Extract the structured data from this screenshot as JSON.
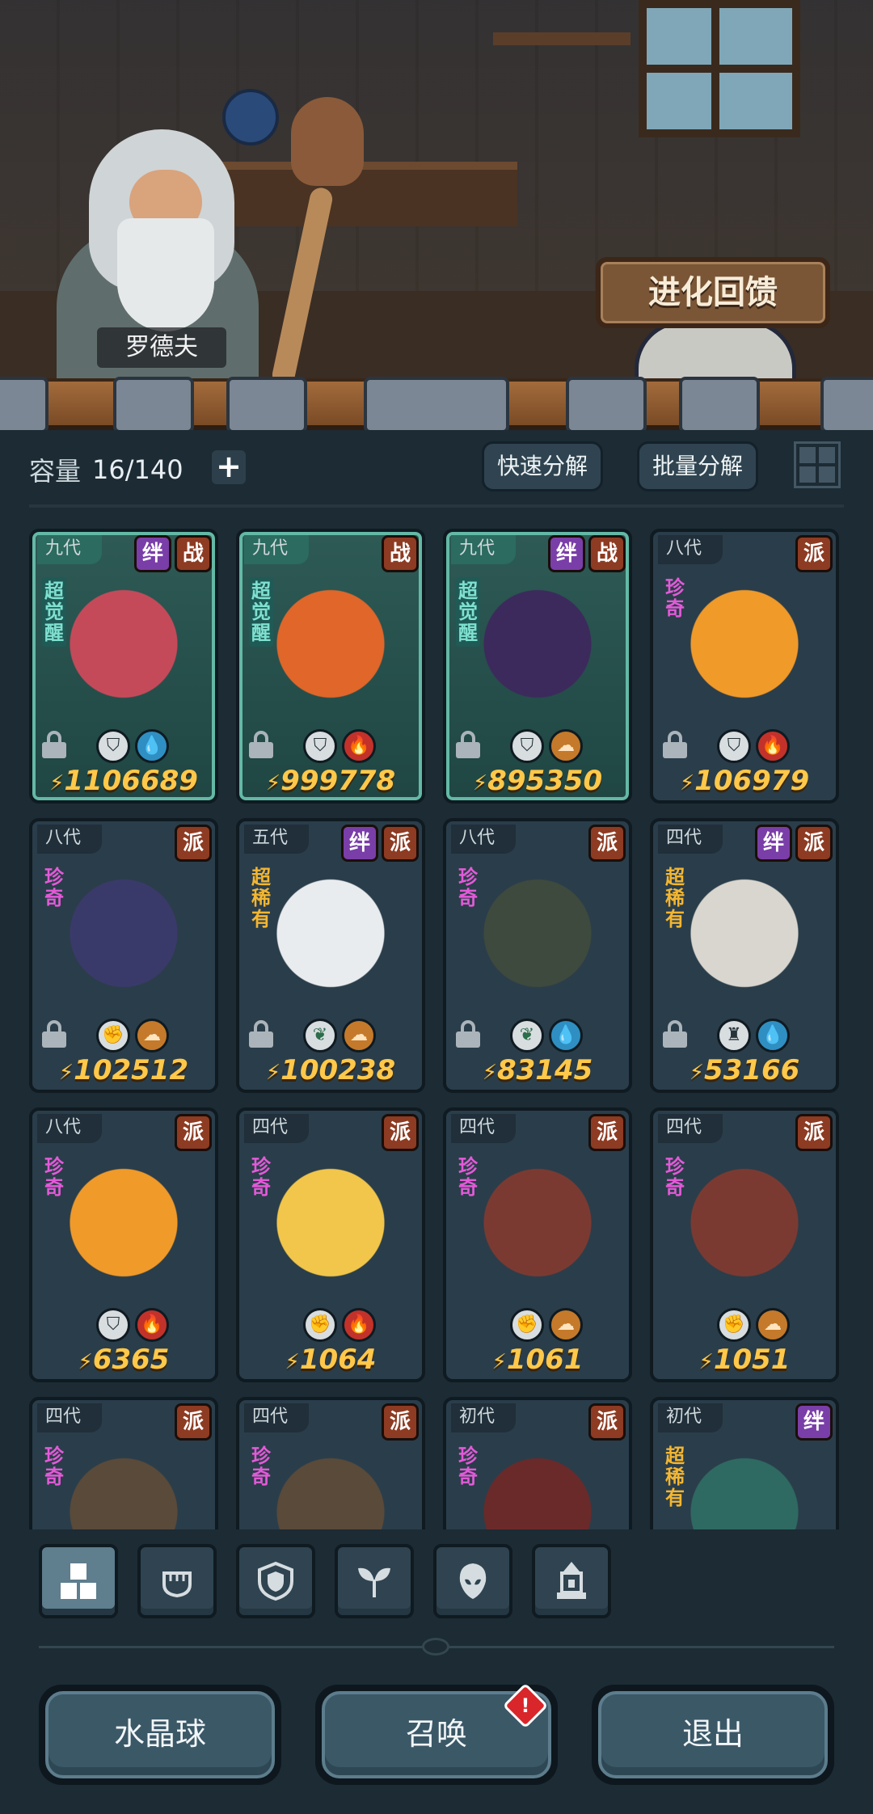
{
  "scene": {
    "npc_name": "罗德夫",
    "evolve_button": "进化回馈"
  },
  "inventory": {
    "capacity_label": "容量",
    "capacity_value": "16/140",
    "add_icon": "plus-icon",
    "quick_decompose": "快速分解",
    "batch_decompose": "批量分解",
    "layout_icon": "grid-view-icon"
  },
  "cards": [
    {
      "gen": "九代",
      "badges": [
        "绊",
        "战"
      ],
      "rarity": "超觉醒",
      "rarity_type": "super",
      "awaken": true,
      "locked": true,
      "elems": [
        "class-shield",
        "water"
      ],
      "power": "1106689",
      "color": "#c44a5a"
    },
    {
      "gen": "九代",
      "badges": [
        "战"
      ],
      "rarity": "超觉醒",
      "rarity_type": "super",
      "awaken": true,
      "locked": true,
      "elems": [
        "class-shield",
        "fire"
      ],
      "power": "999778",
      "color": "#e0662a"
    },
    {
      "gen": "九代",
      "badges": [
        "绊",
        "战"
      ],
      "rarity": "超觉醒",
      "rarity_type": "super",
      "awaken": true,
      "locked": true,
      "elems": [
        "class-shield",
        "earth"
      ],
      "power": "895350",
      "color": "#3c2a5c"
    },
    {
      "gen": "八代",
      "badges": [
        "派"
      ],
      "rarity": "珍奇",
      "rarity_type": "rare",
      "awaken": false,
      "locked": true,
      "elems": [
        "class-shield",
        "fire"
      ],
      "power": "106979",
      "color": "#f09a2a"
    },
    {
      "gen": "八代",
      "badges": [
        "派"
      ],
      "rarity": "珍奇",
      "rarity_type": "rare",
      "awaken": false,
      "locked": true,
      "elems": [
        "class-fist",
        "earth"
      ],
      "power": "102512",
      "color": "#3a3a6a"
    },
    {
      "gen": "五代",
      "badges": [
        "绊",
        "派"
      ],
      "rarity": "超稀有",
      "rarity_type": "superrare",
      "awaken": false,
      "locked": true,
      "elems": [
        "class-leaf",
        "earth"
      ],
      "power": "100238",
      "color": "#e9ecef"
    },
    {
      "gen": "八代",
      "badges": [
        "派"
      ],
      "rarity": "珍奇",
      "rarity_type": "rare",
      "awaken": false,
      "locked": true,
      "elems": [
        "class-leaf",
        "water"
      ],
      "power": "83145",
      "color": "#3e4a3e"
    },
    {
      "gen": "四代",
      "badges": [
        "绊",
        "派"
      ],
      "rarity": "超稀有",
      "rarity_type": "superrare",
      "awaken": false,
      "locked": true,
      "elems": [
        "class-tower",
        "water"
      ],
      "power": "53166",
      "color": "#d9d6cf"
    },
    {
      "gen": "八代",
      "badges": [
        "派"
      ],
      "rarity": "珍奇",
      "rarity_type": "rare",
      "awaken": false,
      "locked": false,
      "elems": [
        "class-shield",
        "fire"
      ],
      "power": "6365",
      "color": "#f09a2a"
    },
    {
      "gen": "四代",
      "badges": [
        "派"
      ],
      "rarity": "珍奇",
      "rarity_type": "rare",
      "awaken": false,
      "locked": false,
      "elems": [
        "class-fist",
        "fire"
      ],
      "power": "1064",
      "color": "#f2c64a"
    },
    {
      "gen": "四代",
      "badges": [
        "派"
      ],
      "rarity": "珍奇",
      "rarity_type": "rare",
      "awaken": false,
      "locked": false,
      "elems": [
        "class-fist",
        "earth"
      ],
      "power": "1061",
      "color": "#7a3a32"
    },
    {
      "gen": "四代",
      "badges": [
        "派"
      ],
      "rarity": "珍奇",
      "rarity_type": "rare",
      "awaken": false,
      "locked": false,
      "elems": [
        "class-fist",
        "earth"
      ],
      "power": "1051",
      "color": "#7a3a32"
    },
    {
      "gen": "四代",
      "badges": [
        "派"
      ],
      "rarity": "珍奇",
      "rarity_type": "rare",
      "awaken": false,
      "locked": false,
      "elems": [],
      "power": "",
      "color": "#5a4a3a"
    },
    {
      "gen": "四代",
      "badges": [
        "派"
      ],
      "rarity": "珍奇",
      "rarity_type": "rare",
      "awaken": false,
      "locked": false,
      "elems": [],
      "power": "",
      "color": "#5a4a3a"
    },
    {
      "gen": "初代",
      "badges": [
        "派"
      ],
      "rarity": "珍奇",
      "rarity_type": "rare",
      "awaken": false,
      "locked": false,
      "elems": [],
      "power": "",
      "color": "#6a2a2a"
    },
    {
      "gen": "初代",
      "badges": [
        "绊"
      ],
      "rarity": "超稀有",
      "rarity_type": "superrare",
      "awaken": false,
      "locked": false,
      "elems": [],
      "power": "",
      "color": "#2f6a62"
    }
  ],
  "filter_tabs": [
    {
      "icon": "all-blocks-icon",
      "active": true
    },
    {
      "icon": "fist-icon",
      "active": false
    },
    {
      "icon": "shield-icon",
      "active": false
    },
    {
      "icon": "leaf-icon",
      "active": false
    },
    {
      "icon": "alien-head-icon",
      "active": false
    },
    {
      "icon": "tower-icon",
      "active": false
    }
  ],
  "bottom": {
    "crystal_ball": "水晶球",
    "summon": "召唤",
    "summon_alert": "!",
    "exit": "退出"
  },
  "colors": {
    "accent_power": "#ffc84a",
    "rarity_rare": "#e35ad8",
    "rarity_superrare": "#f3b632",
    "rarity_awaken": "#7fe0d0",
    "badge_bond": "#7a3ea8",
    "badge_sect": "#8d3b22"
  }
}
